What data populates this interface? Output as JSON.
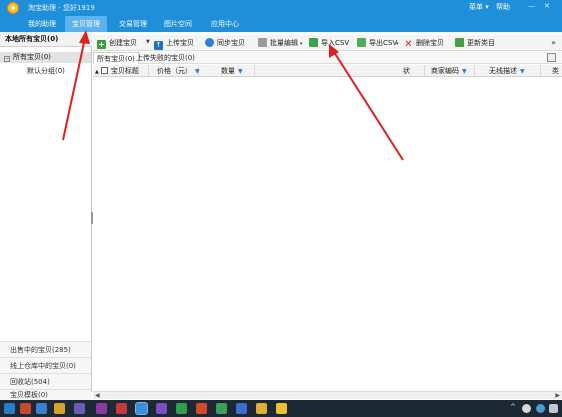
{
  "window": {
    "title": "淘宝助理 - 您好1919",
    "menu_label": "菜单 ▾",
    "help_label": "帮助",
    "minimize": "—",
    "close": "✕"
  },
  "nav": {
    "tabs": [
      {
        "label": "我的助理"
      },
      {
        "label": "宝贝管理"
      },
      {
        "label": "交易管理"
      },
      {
        "label": "图片空间"
      },
      {
        "label": "应用中心"
      }
    ]
  },
  "sidebar": {
    "header": "本地所有宝贝(0)",
    "tree": {
      "expander": "−",
      "root_label": "所有宝贝(0)",
      "child_label": "默认分组(0)"
    },
    "bottom_items": [
      {
        "label": "出售中的宝贝(285)"
      },
      {
        "label": "线上仓库中的宝贝(0)"
      },
      {
        "label": "回收站(504)"
      },
      {
        "label": "宝贝模板(0)"
      }
    ]
  },
  "toolbar": {
    "buttons": [
      {
        "label": "创建宝贝",
        "icon": "plus-icon"
      },
      {
        "label": "上传宝贝",
        "icon": "upload-icon"
      },
      {
        "label": "同步宝贝",
        "icon": "sync-icon"
      },
      {
        "label": "批量编辑",
        "icon": "batch-edit-icon"
      },
      {
        "label": "导入CSV",
        "icon": "import-csv-icon"
      },
      {
        "label": "导出CSV",
        "icon": "export-csv-icon"
      },
      {
        "label": "删除宝贝",
        "icon": "delete-icon"
      },
      {
        "label": "更新类目",
        "icon": "update-category-icon"
      }
    ],
    "more": "»"
  },
  "subtabs": [
    {
      "label": "所有宝贝(0)"
    },
    {
      "label": "上传失败的宝贝(0)"
    }
  ],
  "table": {
    "columns": [
      {
        "label": "宝贝标题"
      },
      {
        "label": "价格（元）"
      },
      {
        "label": "数量"
      },
      {
        "label": "状"
      },
      {
        "label": "商家编码"
      },
      {
        "label": "无线描述"
      },
      {
        "label": "类"
      }
    ],
    "rows": []
  },
  "taskbar": {
    "tray_arrow": "^"
  },
  "colors": {
    "accent": "#1e8fd8",
    "annotation": "#e02020"
  }
}
